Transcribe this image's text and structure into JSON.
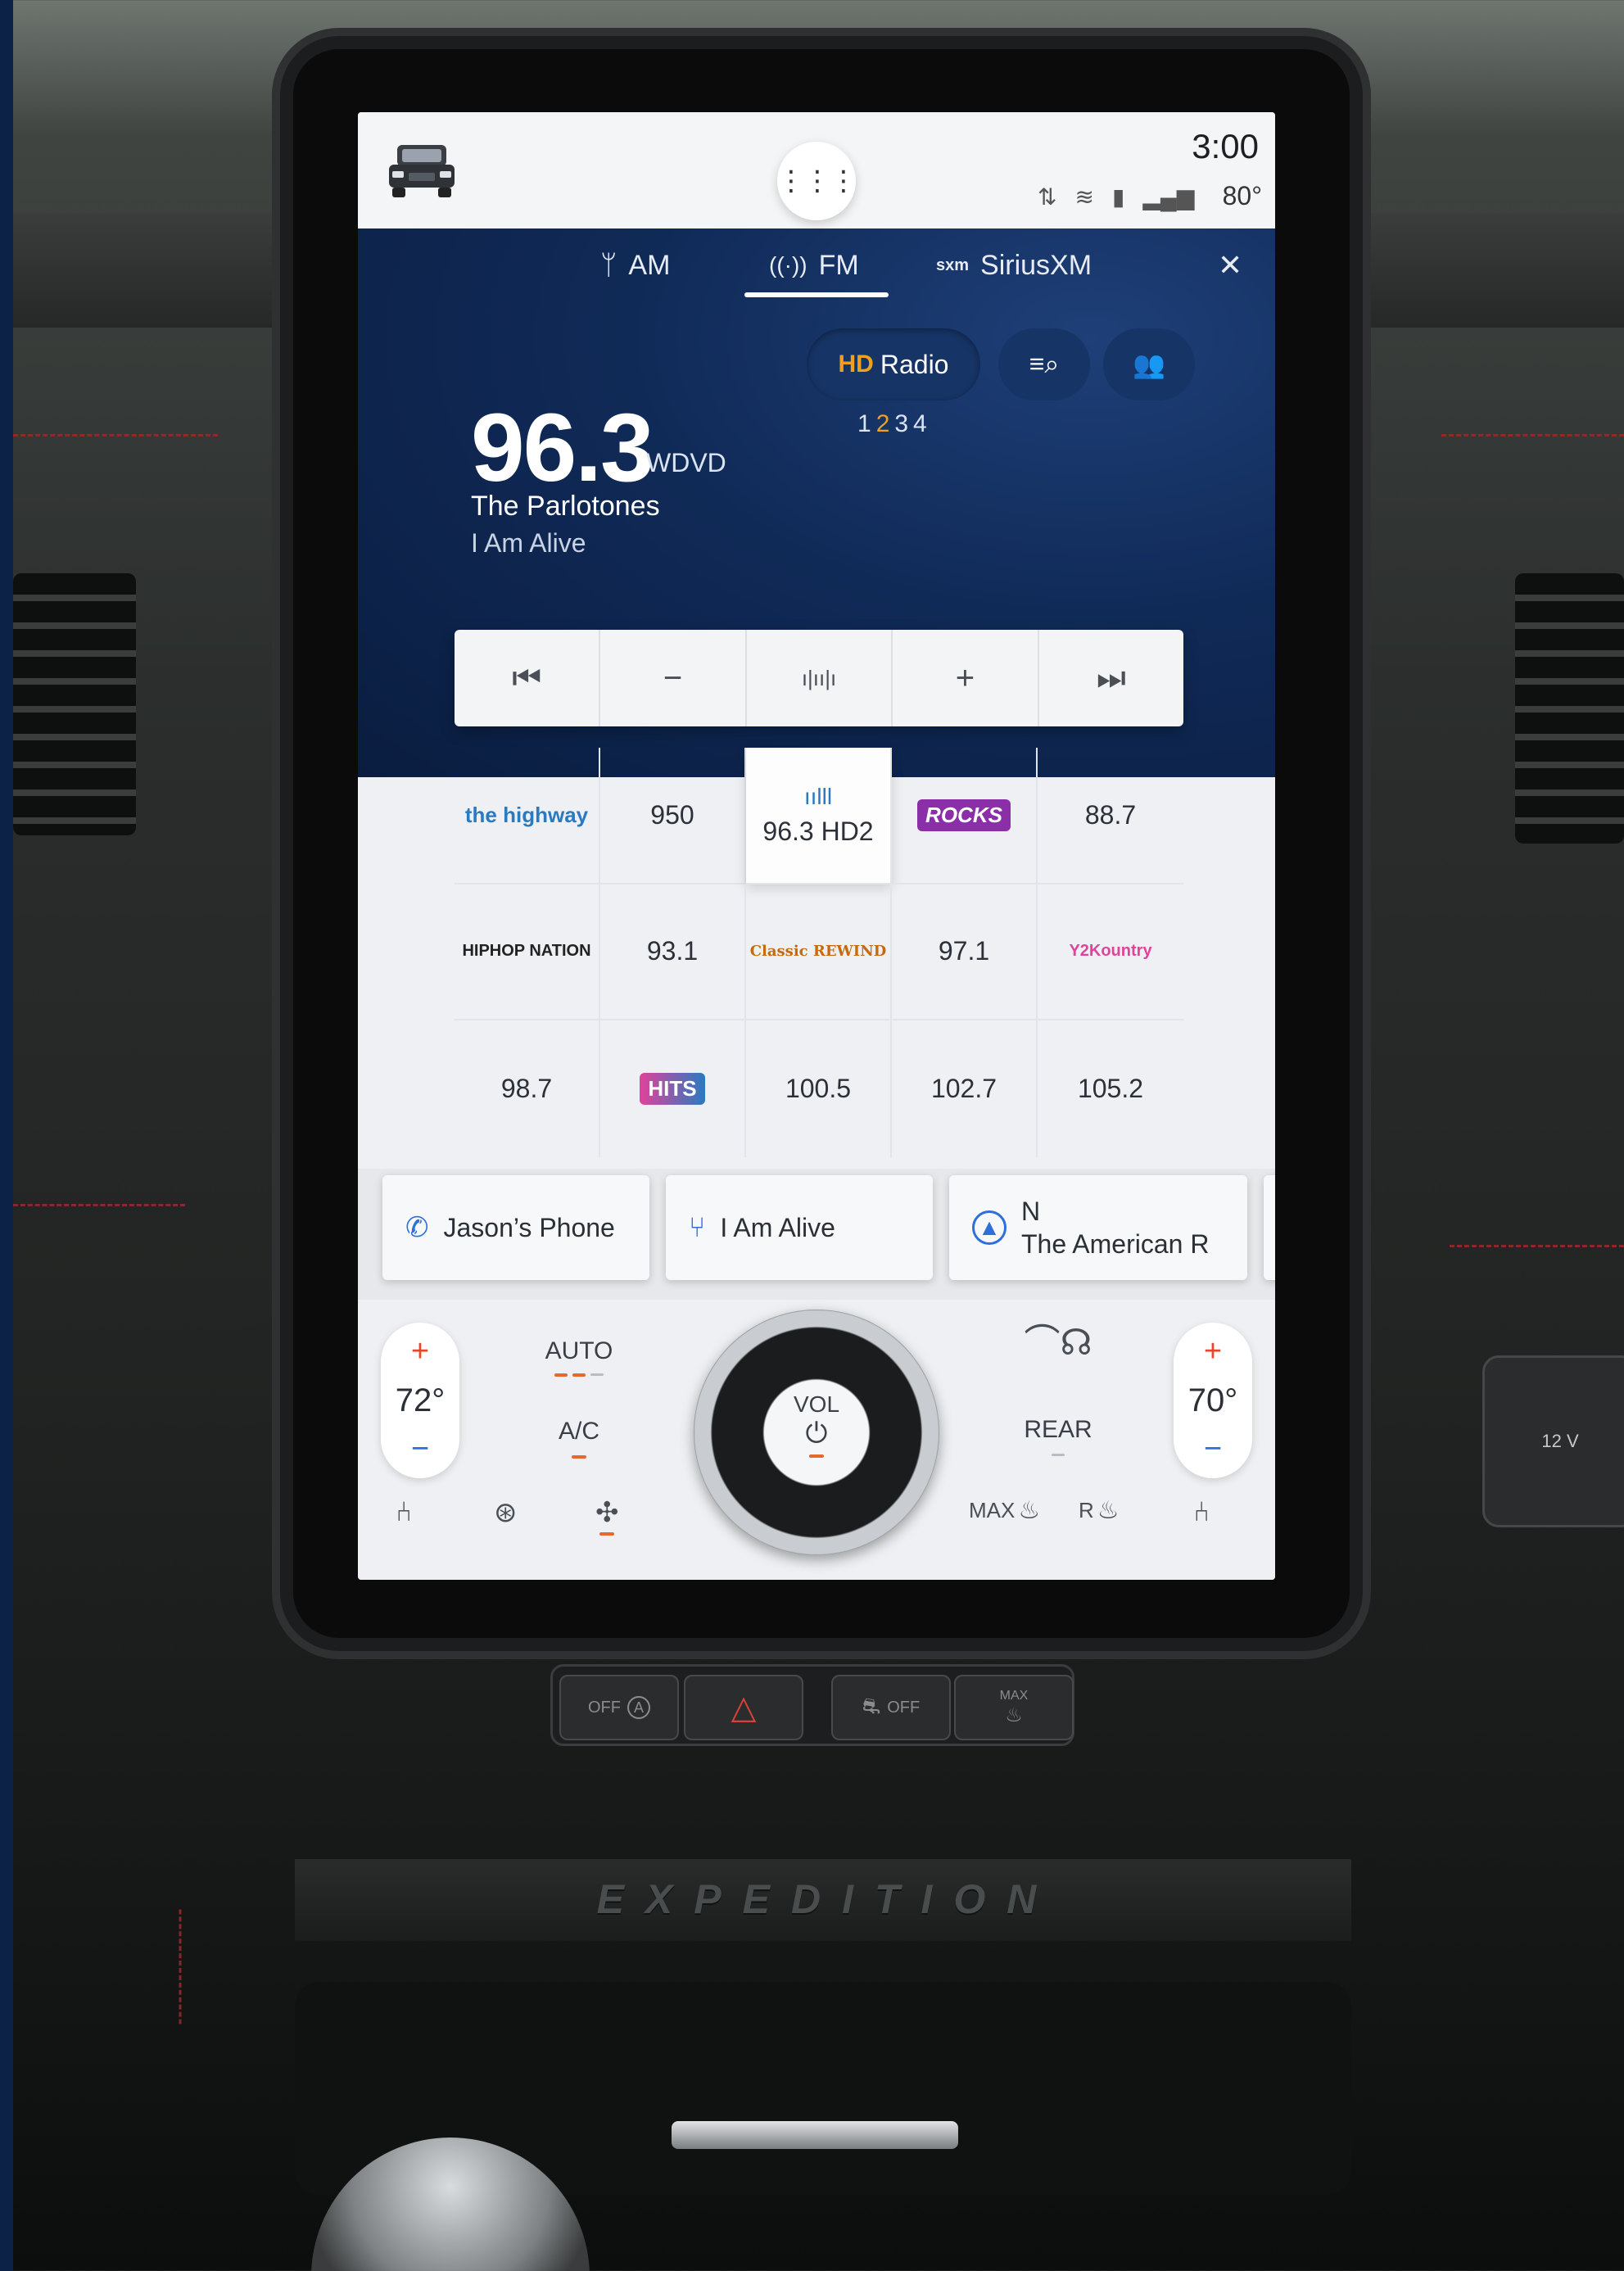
{
  "status": {
    "time": "3:00",
    "outside_temp": "80°"
  },
  "tabs": [
    {
      "label": "AM",
      "icon": "antenna-icon"
    },
    {
      "label": "FM",
      "icon": "broadcast-icon",
      "active": true
    },
    {
      "label": "SiriusXM",
      "icon": "sxm-icon"
    }
  ],
  "radio": {
    "hd_label": "Radio",
    "frequency": "96.3",
    "call_sign": "WDVD",
    "artist": "The Parlotones",
    "song": "I Am Alive",
    "hd_channels": {
      "before": "1",
      "current": "2",
      "after": "34"
    }
  },
  "presets": [
    {
      "type": "logo",
      "label": "the highway"
    },
    {
      "type": "text",
      "label": "950"
    },
    {
      "type": "text",
      "label": "96.3 HD2",
      "active": true
    },
    {
      "type": "logo",
      "label": "ROCKS"
    },
    {
      "type": "text",
      "label": "88.7"
    },
    {
      "type": "logo",
      "label": "HIPHOP NATION"
    },
    {
      "type": "text",
      "label": "93.1"
    },
    {
      "type": "logo",
      "label": "Classic REWIND"
    },
    {
      "type": "text",
      "label": "97.1"
    },
    {
      "type": "logo",
      "label": "Y2Kountry"
    },
    {
      "type": "text",
      "label": "98.7"
    },
    {
      "type": "logo",
      "label": "HITS"
    },
    {
      "type": "text",
      "label": "100.5"
    },
    {
      "type": "text",
      "label": "102.7"
    },
    {
      "type": "text",
      "label": "105.2"
    }
  ],
  "cards": {
    "phone": "Jason’s Phone",
    "usb": "I Am Alive",
    "nav_dir": "N",
    "nav_road": "The American R"
  },
  "climate": {
    "left_temp": "72°",
    "right_temp": "70°",
    "auto": "AUTO",
    "ac": "A/C",
    "vol": "VOL",
    "rear": "REAR",
    "max_label": "MAX",
    "rear_defrost": "R"
  },
  "hardware": {
    "off_label": "OFF",
    "off2_label": "OFF",
    "max_label": "MAX",
    "plug_label": "12 V"
  },
  "console": {
    "brand": "EXPEDITION"
  },
  "colors": {
    "accent_orange": "#e8672e",
    "header_navy": "#102a57",
    "hd_channel_active": "#f0a020"
  }
}
